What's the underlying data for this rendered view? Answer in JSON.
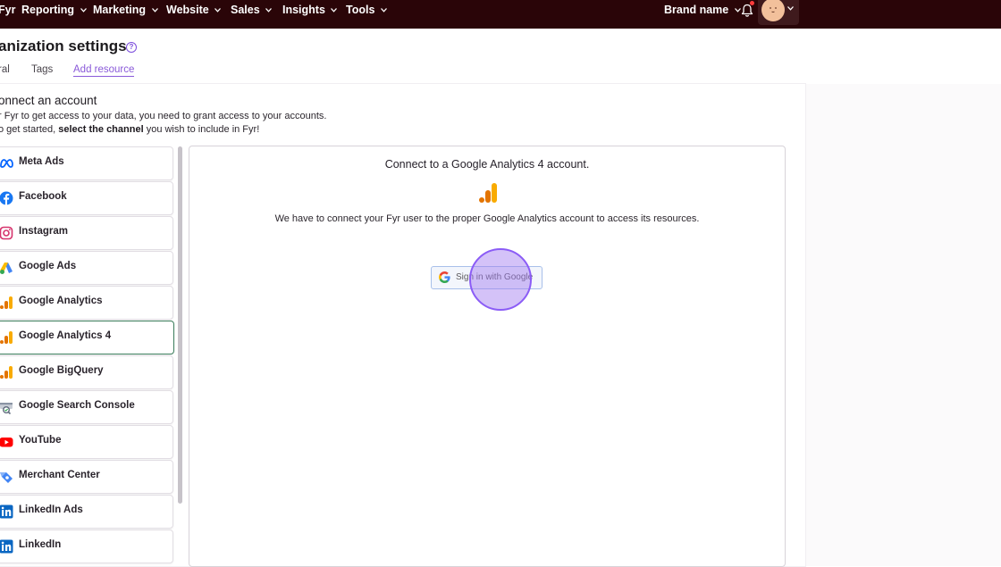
{
  "nav": {
    "brand": "Fyr",
    "items": [
      "Reporting",
      "Marketing",
      "Website",
      "Sales",
      "Insights",
      "Tools"
    ],
    "brand_selector": "Brand name"
  },
  "page": {
    "title": "anization settings",
    "tabs": [
      "ral",
      "Tags",
      "Add resource"
    ],
    "active_tab": "Add resource"
  },
  "connect": {
    "title": "onnect an account",
    "desc_line1": "r Fyr to get access to your data, you need to grant access to your accounts.",
    "desc_line2_pre": "o get started, ",
    "desc_line2_bold": "select the channel",
    "desc_line2_post": " you wish to include in Fyr!"
  },
  "channels": [
    {
      "label": "Meta Ads",
      "icon": "meta-icon"
    },
    {
      "label": "Facebook",
      "icon": "facebook-icon"
    },
    {
      "label": "Instagram",
      "icon": "instagram-icon"
    },
    {
      "label": "Google Ads",
      "icon": "google-ads-icon"
    },
    {
      "label": "Google Analytics",
      "icon": "google-analytics-icon"
    },
    {
      "label": "Google Analytics 4",
      "icon": "google-analytics-icon"
    },
    {
      "label": "Google BigQuery",
      "icon": "google-bigquery-icon"
    },
    {
      "label": "Google Search Console",
      "icon": "google-search-console-icon"
    },
    {
      "label": "YouTube",
      "icon": "youtube-icon"
    },
    {
      "label": "Merchant Center",
      "icon": "merchant-center-icon"
    },
    {
      "label": "LinkedIn Ads",
      "icon": "linkedin-icon"
    },
    {
      "label": "LinkedIn",
      "icon": "linkedin-icon"
    }
  ],
  "selected_channel": "Google Analytics 4",
  "detail": {
    "title": "Connect to a Google Analytics 4 account.",
    "desc": "We have to connect your Fyr user to the proper Google Analytics account to access its resources.",
    "button": "Sign in with Google"
  },
  "colors": {
    "nav_bg": "#2a0508",
    "accent": "#8a5ad9",
    "selected_border": "#3b7d5c",
    "ga_orange": "#f9ab00",
    "ga_dark": "#e37400"
  }
}
